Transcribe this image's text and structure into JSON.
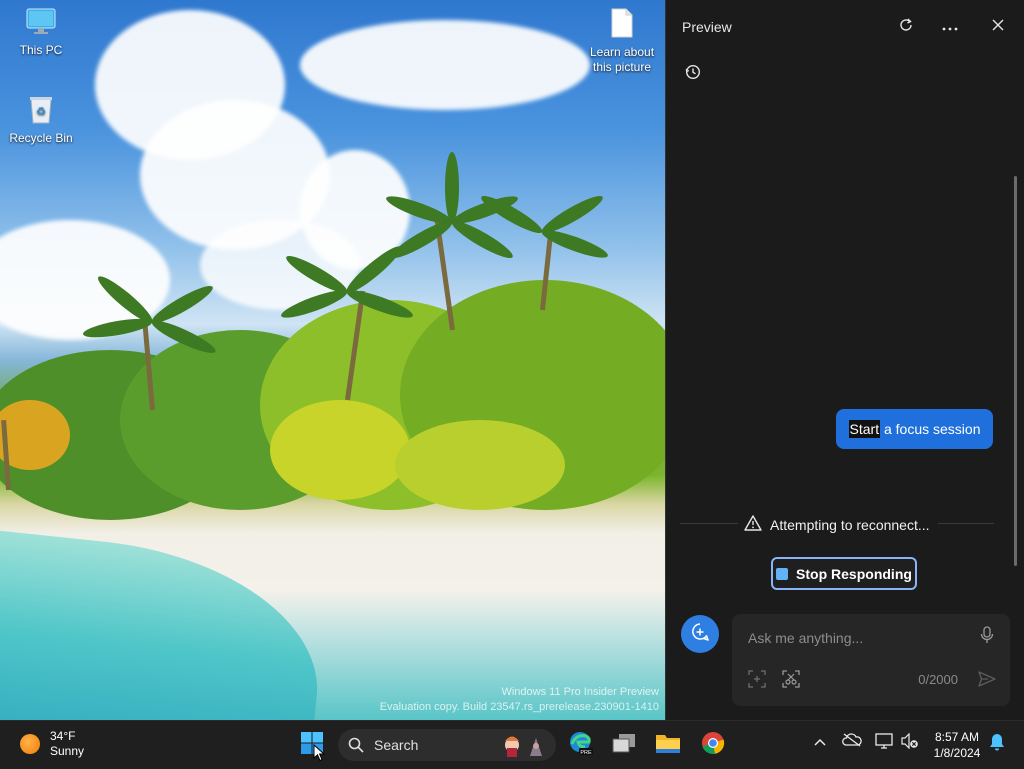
{
  "desktop": {
    "icons": [
      {
        "label": "This PC"
      },
      {
        "label": "Recycle Bin"
      },
      {
        "label": "Learn about this picture"
      }
    ],
    "watermark": {
      "line1": "Windows 11 Pro Insider Preview",
      "line2": "Evaluation copy. Build 23547.rs_prerelease.230901-1410"
    }
  },
  "panel": {
    "title": "Preview",
    "user_message": {
      "highlighted": "Start",
      "rest": " a focus session"
    },
    "status": "Attempting to reconnect...",
    "stop_button": "Stop Responding",
    "input": {
      "placeholder": "Ask me anything...",
      "counter": "0/2000"
    },
    "icons": [
      "refresh-icon",
      "more-icon",
      "close-icon",
      "history-icon",
      "warning-icon",
      "stop-icon",
      "new-topic-icon",
      "microphone-icon",
      "image-add-icon",
      "screenshot-icon",
      "send-icon"
    ]
  },
  "taskbar": {
    "weather": {
      "temp": "34°F",
      "condition": "Sunny"
    },
    "search_label": "Search",
    "clock": {
      "time": "8:57 AM",
      "date": "1/8/2024"
    },
    "apps": [
      "start-icon",
      "search-icon",
      "edge-icon",
      "task-view-icon",
      "file-explorer-icon",
      "chrome-icon"
    ],
    "tray": [
      "chevron-up-icon",
      "onedrive-icon",
      "display-icon",
      "volume-muted-icon",
      "notification-bell-icon"
    ]
  },
  "colors": {
    "accent": "#1f6fdc",
    "panel_bg": "#1b1b1b",
    "taskbar_bg": "#1f1f1f",
    "stop_border": "#8ab4f8"
  }
}
